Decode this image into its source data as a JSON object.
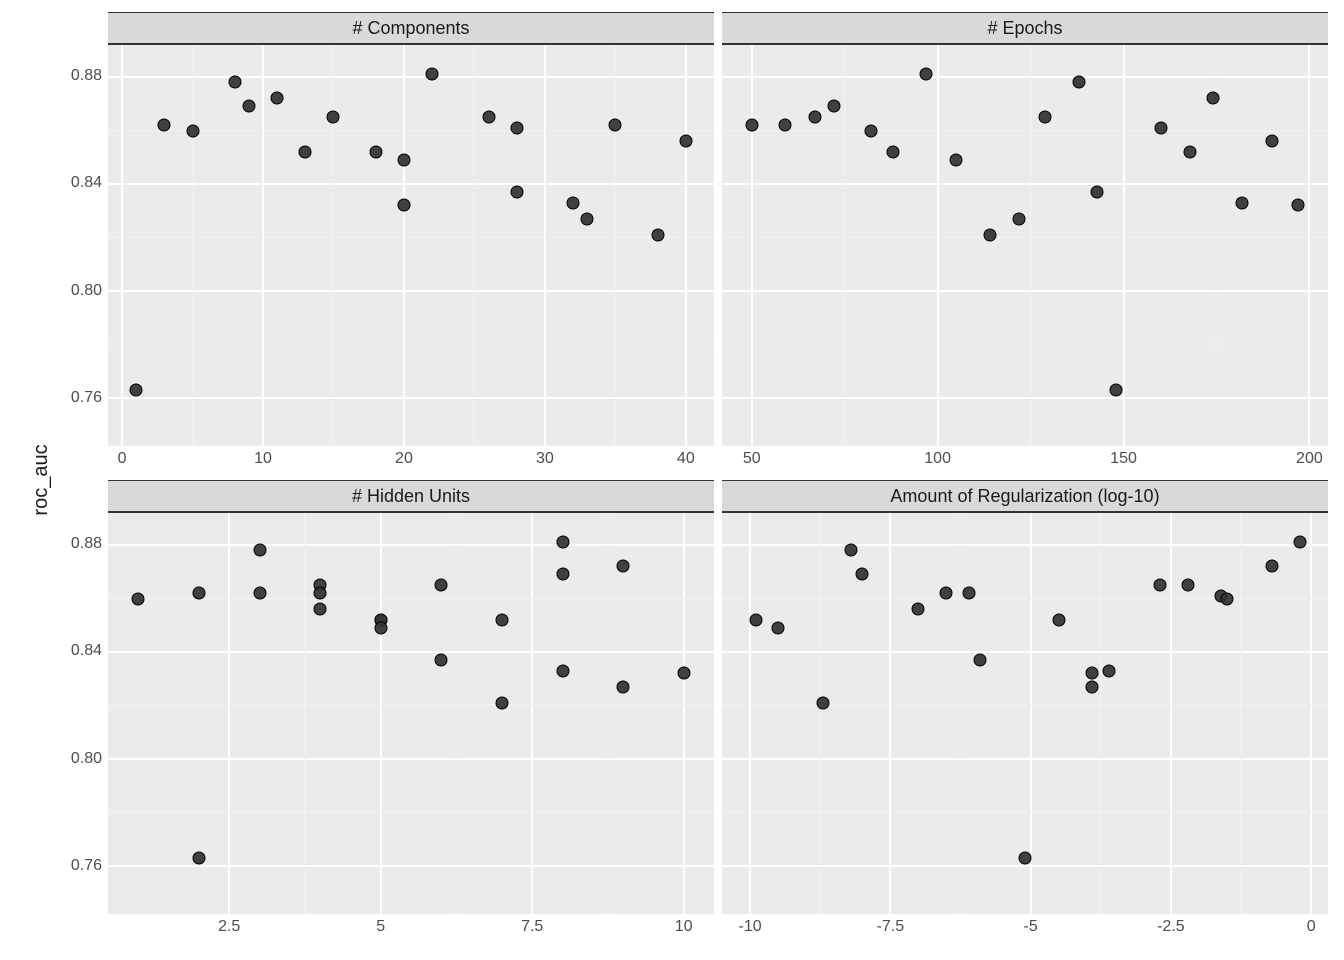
{
  "ylab": "roc_auc",
  "chart_data": [
    {
      "name": "components",
      "type": "scatter",
      "title": "# Components",
      "xlabel": "",
      "ylabel": "roc_auc",
      "xlim": [
        -1,
        42
      ],
      "ylim": [
        0.742,
        0.892
      ],
      "xticks": [
        0,
        10,
        20,
        30,
        40
      ],
      "yticks": [
        0.76,
        0.8,
        0.84,
        0.88
      ],
      "points": [
        {
          "x": 1,
          "y": 0.763
        },
        {
          "x": 3,
          "y": 0.862
        },
        {
          "x": 5,
          "y": 0.86
        },
        {
          "x": 8,
          "y": 0.878
        },
        {
          "x": 9,
          "y": 0.869
        },
        {
          "x": 11,
          "y": 0.872
        },
        {
          "x": 13,
          "y": 0.852
        },
        {
          "x": 15,
          "y": 0.865
        },
        {
          "x": 18,
          "y": 0.852
        },
        {
          "x": 20,
          "y": 0.849
        },
        {
          "x": 20,
          "y": 0.832
        },
        {
          "x": 22,
          "y": 0.881
        },
        {
          "x": 26,
          "y": 0.865
        },
        {
          "x": 28,
          "y": 0.861
        },
        {
          "x": 28,
          "y": 0.837
        },
        {
          "x": 32,
          "y": 0.833
        },
        {
          "x": 33,
          "y": 0.827
        },
        {
          "x": 35,
          "y": 0.862
        },
        {
          "x": 38,
          "y": 0.821
        },
        {
          "x": 40,
          "y": 0.856
        }
      ]
    },
    {
      "name": "epochs",
      "type": "scatter",
      "title": "# Epochs",
      "xlabel": "",
      "ylabel": "roc_auc",
      "xlim": [
        42,
        205
      ],
      "ylim": [
        0.742,
        0.892
      ],
      "xticks": [
        50,
        100,
        150,
        200
      ],
      "yticks": [
        0.76,
        0.8,
        0.84,
        0.88
      ],
      "points": [
        {
          "x": 50,
          "y": 0.862
        },
        {
          "x": 59,
          "y": 0.862
        },
        {
          "x": 67,
          "y": 0.865
        },
        {
          "x": 72,
          "y": 0.869
        },
        {
          "x": 82,
          "y": 0.86
        },
        {
          "x": 88,
          "y": 0.852
        },
        {
          "x": 97,
          "y": 0.881
        },
        {
          "x": 105,
          "y": 0.849
        },
        {
          "x": 114,
          "y": 0.821
        },
        {
          "x": 122,
          "y": 0.827
        },
        {
          "x": 129,
          "y": 0.865
        },
        {
          "x": 138,
          "y": 0.878
        },
        {
          "x": 143,
          "y": 0.837
        },
        {
          "x": 148,
          "y": 0.763
        },
        {
          "x": 160,
          "y": 0.861
        },
        {
          "x": 168,
          "y": 0.852
        },
        {
          "x": 174,
          "y": 0.872
        },
        {
          "x": 182,
          "y": 0.833
        },
        {
          "x": 190,
          "y": 0.856
        },
        {
          "x": 197,
          "y": 0.832
        }
      ]
    },
    {
      "name": "hidden_units",
      "type": "scatter",
      "title": "# Hidden Units",
      "xlabel": "",
      "ylabel": "roc_auc",
      "xlim": [
        0.5,
        10.5
      ],
      "ylim": [
        0.742,
        0.892
      ],
      "xticks": [
        2.5,
        5.0,
        7.5,
        10.0
      ],
      "yticks": [
        0.76,
        0.8,
        0.84,
        0.88
      ],
      "points": [
        {
          "x": 1,
          "y": 0.86
        },
        {
          "x": 2,
          "y": 0.862
        },
        {
          "x": 2,
          "y": 0.763
        },
        {
          "x": 3,
          "y": 0.878
        },
        {
          "x": 3,
          "y": 0.862
        },
        {
          "x": 4,
          "y": 0.865
        },
        {
          "x": 4,
          "y": 0.862
        },
        {
          "x": 4,
          "y": 0.856
        },
        {
          "x": 5,
          "y": 0.852
        },
        {
          "x": 5,
          "y": 0.852
        },
        {
          "x": 5,
          "y": 0.849
        },
        {
          "x": 6,
          "y": 0.865
        },
        {
          "x": 6,
          "y": 0.837
        },
        {
          "x": 7,
          "y": 0.852
        },
        {
          "x": 7,
          "y": 0.821
        },
        {
          "x": 8,
          "y": 0.881
        },
        {
          "x": 8,
          "y": 0.869
        },
        {
          "x": 8,
          "y": 0.833
        },
        {
          "x": 9,
          "y": 0.872
        },
        {
          "x": 9,
          "y": 0.827
        },
        {
          "x": 10,
          "y": 0.832
        }
      ]
    },
    {
      "name": "regularization",
      "type": "scatter",
      "title": "Amount of Regularization (log-10)",
      "xlabel": "",
      "ylabel": "roc_auc",
      "xlim": [
        -10.5,
        0.3
      ],
      "ylim": [
        0.742,
        0.892
      ],
      "xticks": [
        -10.0,
        -7.5,
        -5.0,
        -2.5,
        0.0
      ],
      "yticks": [
        0.76,
        0.8,
        0.84,
        0.88
      ],
      "points": [
        {
          "x": -9.9,
          "y": 0.852
        },
        {
          "x": -9.5,
          "y": 0.849
        },
        {
          "x": -8.7,
          "y": 0.821
        },
        {
          "x": -8.2,
          "y": 0.878
        },
        {
          "x": -8.0,
          "y": 0.869
        },
        {
          "x": -7.0,
          "y": 0.856
        },
        {
          "x": -6.5,
          "y": 0.862
        },
        {
          "x": -6.1,
          "y": 0.862
        },
        {
          "x": -5.9,
          "y": 0.837
        },
        {
          "x": -5.1,
          "y": 0.763
        },
        {
          "x": -4.5,
          "y": 0.852
        },
        {
          "x": -3.9,
          "y": 0.832
        },
        {
          "x": -3.9,
          "y": 0.827
        },
        {
          "x": -3.6,
          "y": 0.833
        },
        {
          "x": -2.7,
          "y": 0.865
        },
        {
          "x": -2.2,
          "y": 0.865
        },
        {
          "x": -1.6,
          "y": 0.861
        },
        {
          "x": -1.5,
          "y": 0.86
        },
        {
          "x": -0.7,
          "y": 0.872
        },
        {
          "x": -0.2,
          "y": 0.881
        }
      ]
    }
  ]
}
